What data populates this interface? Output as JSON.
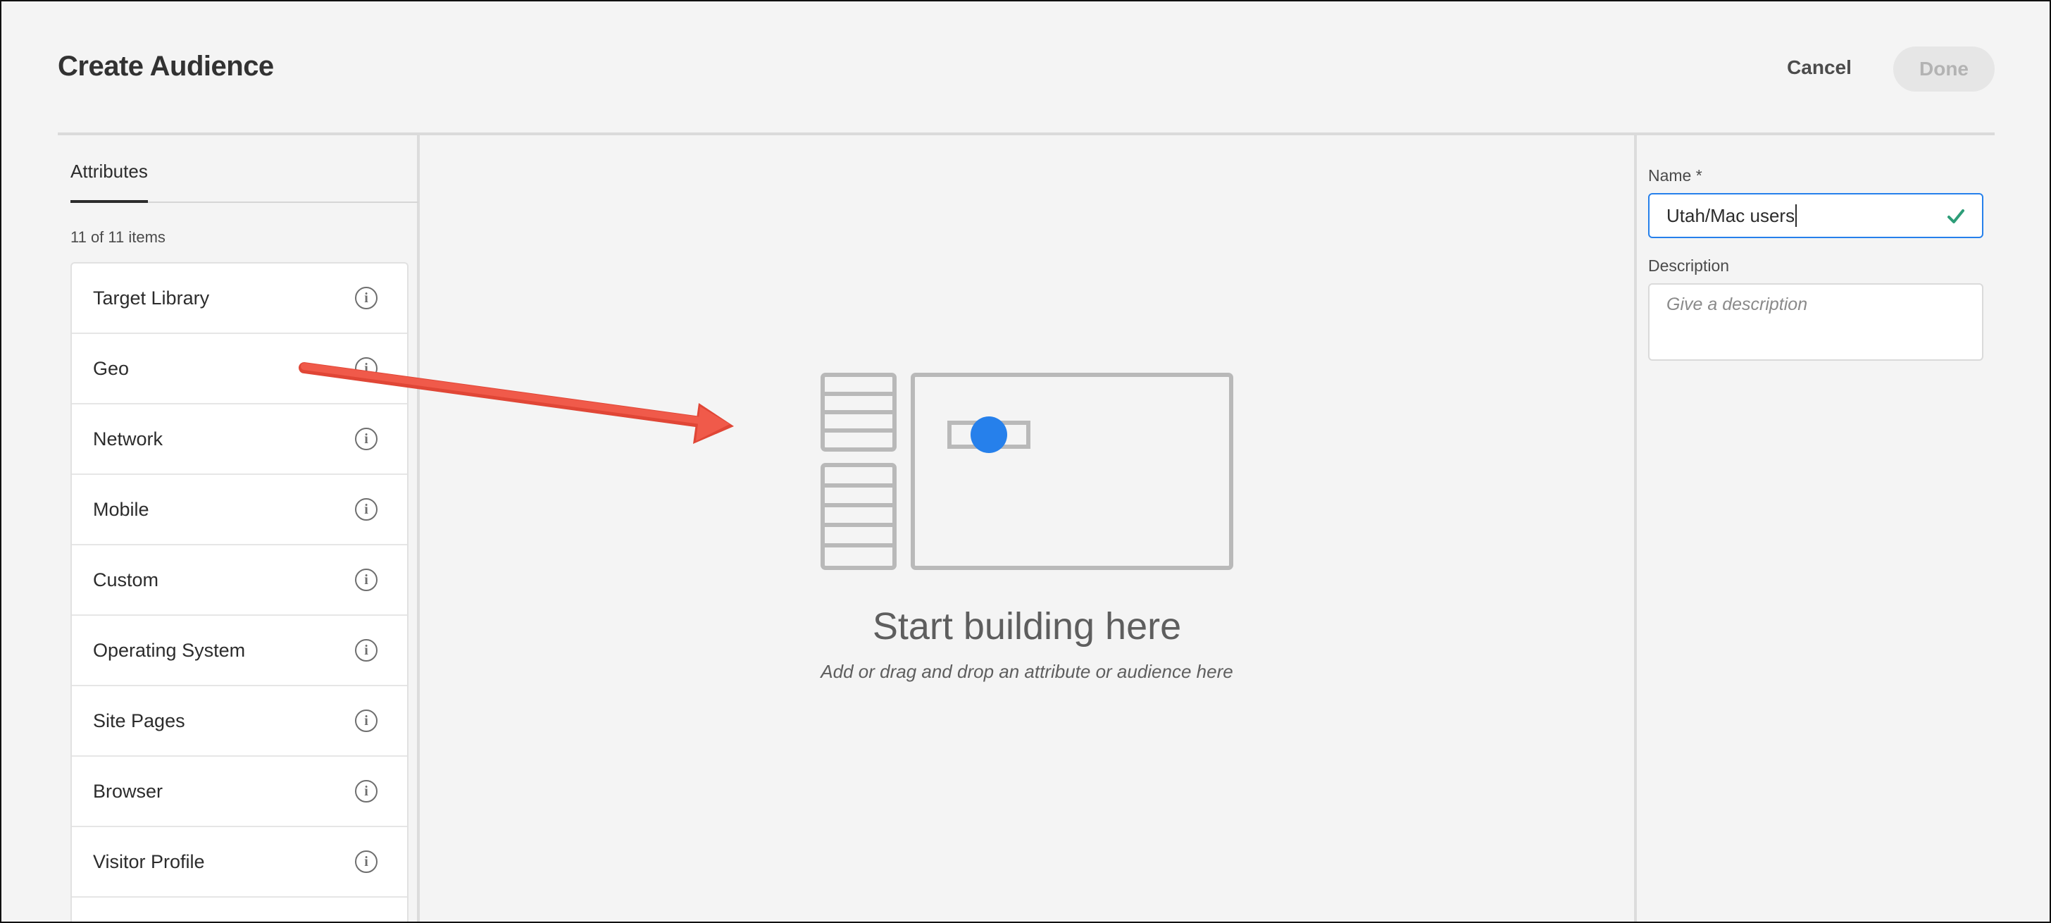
{
  "header": {
    "title": "Create Audience",
    "cancel_label": "Cancel",
    "done_label": "Done"
  },
  "left_panel": {
    "tab_label": "Attributes",
    "items_count": "11 of 11 items",
    "items": [
      {
        "label": "Target Library",
        "icon": "info-icon"
      },
      {
        "label": "Geo",
        "icon": "info-icon"
      },
      {
        "label": "Network",
        "icon": "info-icon"
      },
      {
        "label": "Mobile",
        "icon": "info-icon"
      },
      {
        "label": "Custom",
        "icon": "info-icon"
      },
      {
        "label": "Operating System",
        "icon": "info-icon"
      },
      {
        "label": "Site Pages",
        "icon": "info-icon"
      },
      {
        "label": "Browser",
        "icon": "info-icon"
      },
      {
        "label": "Visitor Profile",
        "icon": "info-icon"
      }
    ]
  },
  "canvas": {
    "empty_title": "Start building here",
    "empty_subtitle": "Add or drag and drop an attribute or audience here"
  },
  "right_panel": {
    "name_label": "Name *",
    "name_value": "Utah/Mac users",
    "description_label": "Description",
    "description_placeholder": "Give a description"
  },
  "colors": {
    "accent_blue": "#2680eb",
    "valid_green": "#2d9d78",
    "annotation_arrow": "#f05a4a"
  }
}
